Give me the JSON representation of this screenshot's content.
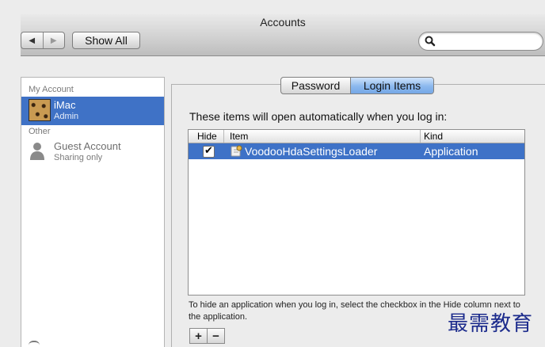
{
  "window": {
    "title": "Accounts"
  },
  "toolbar": {
    "back_glyph": "◀",
    "forward_glyph": "▶",
    "show_all_label": "Show All",
    "search_icon": "magnifier-icon",
    "search_value": ""
  },
  "sidebar": {
    "my_account_header": "My Account",
    "my_account": {
      "name": "iMac",
      "role": "Admin",
      "avatar": "leopard-avatar"
    },
    "other_header": "Other",
    "guest": {
      "name": "Guest Account",
      "role": "Sharing only",
      "icon": "person-silhouette-icon"
    }
  },
  "tabs": {
    "password": "Password",
    "login_items": "Login Items",
    "selected": "Login Items"
  },
  "login_items": {
    "heading": "These items will open automatically when you log in:",
    "columns": {
      "hide": "Hide",
      "item": "Item",
      "kind": "Kind"
    },
    "rows": [
      {
        "hide": true,
        "check_glyph": "✔",
        "item": "VoodooHdaSettingsLoader",
        "kind": "Application",
        "icon": "app-icon"
      }
    ],
    "hint": "To hide an application when you log in, select the checkbox in the Hide column next to the application.",
    "add_label": "+",
    "remove_label": "−"
  },
  "watermark": "最需教育",
  "colors": {
    "selection": "#3e72c7",
    "tab_selected": "#8bb8ee",
    "watermark": "#1c2b8c"
  }
}
